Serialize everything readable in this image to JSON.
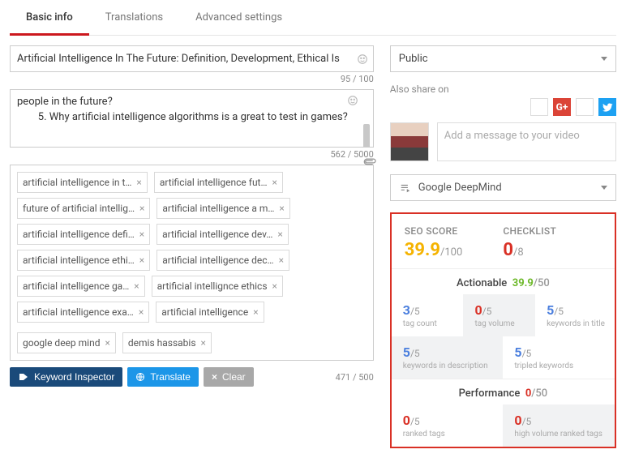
{
  "tabs": {
    "basic": "Basic info",
    "translations": "Translations",
    "advanced": "Advanced settings"
  },
  "title": {
    "value": "Artificial Intelligence In The Future: Definition, Development, Ethical Is",
    "counter": "95 / 100"
  },
  "description": {
    "lines": [
      "people in the future?",
      "        5. Why artificial intelligence algorithms is a great to test in games?"
    ],
    "counter": "562 / 5000"
  },
  "tags": {
    "items": [
      "artificial intelligence in t…",
      "artificial intelligence fut…",
      "future of artificial intellig…",
      "artificial intelligence a m…",
      "artificial intelligence defi…",
      "artificial intelligence dev…",
      "artificial intelligence ethi…",
      "artificial intelligence dec…",
      "artificial intelligence ga…",
      "artificial intellignce ethics",
      "artificial intelligence exa…",
      "artificial intelligence",
      "google deep mind",
      "demis hassabis"
    ],
    "counter": "471 / 500"
  },
  "buttons": {
    "ki": "Keyword Inspector",
    "tr": "Translate",
    "cl": "Clear"
  },
  "privacy": {
    "value": "Public"
  },
  "share": {
    "label": "Also share on",
    "placeholder": "Add a message to your video"
  },
  "playlist": {
    "value": "Google DeepMind"
  },
  "seo": {
    "score_label": "SEO SCORE",
    "score_val": "39.9",
    "score_den": "/100",
    "check_label": "CHECKLIST",
    "check_val": "0",
    "check_den": "/8",
    "actionable": {
      "title": "Actionable",
      "score": "39.9",
      "den": "/50",
      "cells": [
        {
          "v": "3",
          "d": "/5",
          "l": "tag count",
          "color": "c-blue",
          "gray": false
        },
        {
          "v": "0",
          "d": "/5",
          "l": "tag volume",
          "color": "c-red",
          "gray": true
        },
        {
          "v": "5",
          "d": "/5",
          "l": "keywords in title",
          "color": "c-blue",
          "gray": false
        },
        {
          "v": "5",
          "d": "/5",
          "l": "keywords in description",
          "color": "c-blue",
          "gray": true
        },
        {
          "v": "5",
          "d": "/5",
          "l": "tripled keywords",
          "color": "c-blue",
          "gray": false
        }
      ]
    },
    "performance": {
      "title": "Performance",
      "score": "0",
      "den": "/50",
      "cells": [
        {
          "v": "0",
          "d": "/5",
          "l": "ranked tags",
          "color": "c-red",
          "gray": false
        },
        {
          "v": "0",
          "d": "/5",
          "l": "high volume ranked tags",
          "color": "c-red",
          "gray": true
        }
      ]
    }
  }
}
